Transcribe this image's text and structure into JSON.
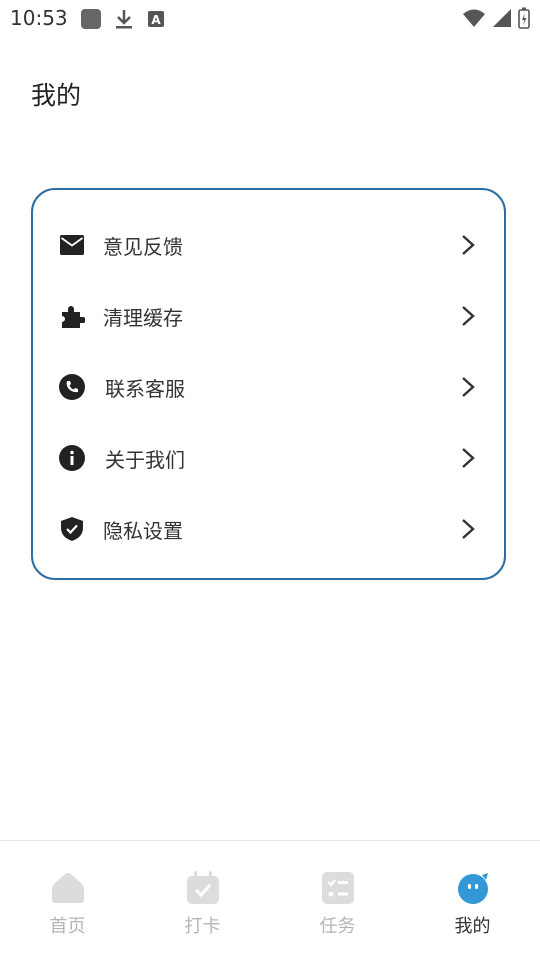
{
  "status_bar": {
    "time": "10:53",
    "icons": [
      "app-square-icon",
      "download-icon",
      "keyboard-a-icon",
      "wifi-icon",
      "signal-icon",
      "battery-icon"
    ]
  },
  "page": {
    "title": "我的"
  },
  "menu": {
    "items": [
      {
        "label": "意见反馈",
        "icon": "mail-icon"
      },
      {
        "label": "清理缓存",
        "icon": "puzzle-icon"
      },
      {
        "label": "联系客服",
        "icon": "phone-icon"
      },
      {
        "label": "关于我们",
        "icon": "info-icon"
      },
      {
        "label": "隐私设置",
        "icon": "shield-check-icon"
      }
    ]
  },
  "tabs": [
    {
      "label": "首页",
      "icon": "home-icon",
      "active": false
    },
    {
      "label": "打卡",
      "icon": "calendar-check-icon",
      "active": false
    },
    {
      "label": "任务",
      "icon": "task-list-icon",
      "active": false
    },
    {
      "label": "我的",
      "icon": "profile-face-icon",
      "active": true
    }
  ],
  "colors": {
    "accent": "#2b6ea3",
    "active_tab_icon": "#3399d6",
    "inactive_tab": "#dcdcdc",
    "text": "#333333"
  }
}
